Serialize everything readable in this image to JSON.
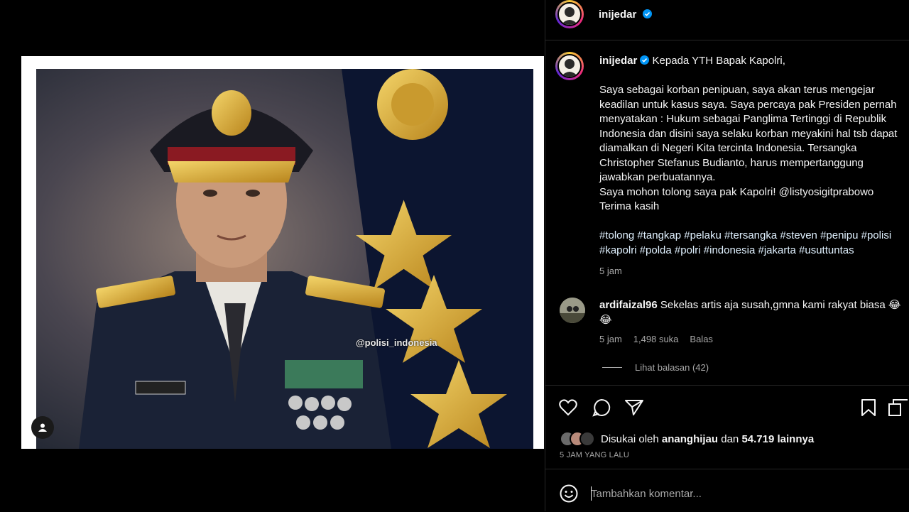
{
  "post": {
    "photo_watermark": "@polisi_indonesia",
    "photo_nameplate": "L.SIGIT PRABOWO"
  },
  "header": {
    "username": "inijedar"
  },
  "caption": {
    "username": "inijedar",
    "greeting": "Kepada YTH Bapak Kapolri,",
    "body": "Saya sebagai korban penipuan, saya akan terus mengejar\nkeadilan untuk kasus saya. Saya percaya pak Presiden pernah\nmenyatakan : Hukum sebagai Panglima Tertinggi di Republik\nIndonesia dan disini saya selaku korban meyakini hal tsb dapat\ndiamalkan di Negeri Kita tercinta Indonesia. Tersangka\nChristopher Stefanus Budianto, harus mempertanggung\njawabkan perbuatannya.\nSaya mohon tolong saya pak Kapolri! @listyosigitprabowo\nTerima kasih",
    "hashtags": "#tolong #tangkap #pelaku #tersangka #steven #penipu #polisi\n#kapolri #polda #polri #indonesia #jakarta #usuttuntas",
    "time": "5 jam"
  },
  "comment": {
    "username": "ardifaizal96",
    "text": "Sekelas artis aja susah,gmna kami rakyat biasa 😂",
    "text_cont": "😂",
    "time": "5 jam",
    "likes": "1,498 suka",
    "reply": "Balas",
    "view_replies": "Lihat balasan (42)"
  },
  "likes": {
    "prefix": "Disukai oleh",
    "user": "ananghijau",
    "mid": "dan",
    "count": "54.719 lainnya"
  },
  "timestamp": "5 JAM YANG LALU",
  "add_comment": {
    "placeholder": "Tambahkan komentar..."
  },
  "colors": {
    "background": "#000000",
    "verified": "#0095f6",
    "muted": "#a8a8a8",
    "divider": "#262626"
  }
}
